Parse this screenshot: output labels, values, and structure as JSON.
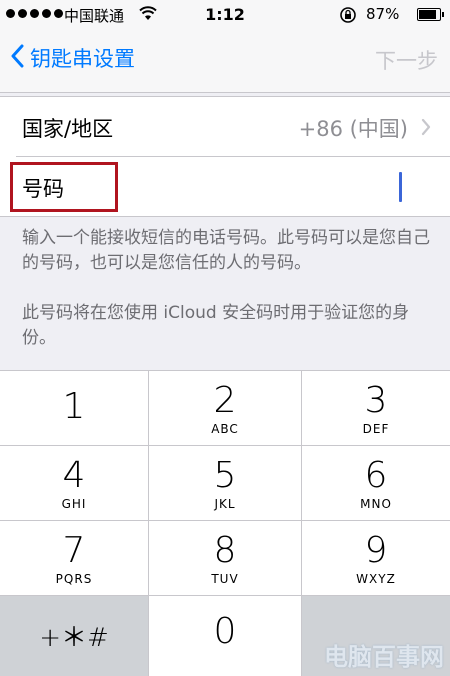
{
  "status_bar": {
    "carrier": "中国联通",
    "time": "1:12",
    "battery": "87%",
    "battery_level": 0.87
  },
  "nav": {
    "back_label": "钥匙串设置",
    "next_label": "下一步"
  },
  "form": {
    "country_label": "国家/地区",
    "country_value": "+86 (中国)",
    "phone_label": "号码",
    "phone_value": ""
  },
  "footer": {
    "line1": "输入一个能接收短信的电话号码。此号码可以是您自己的号码，也可以是您信任的人的号码。",
    "line2": "此号码将在您使用 iCloud 安全码时用于验证您的身份。"
  },
  "keypad": {
    "k1": {
      "num": "1",
      "letters": ""
    },
    "k2": {
      "num": "2",
      "letters": "ABC"
    },
    "k3": {
      "num": "3",
      "letters": "DEF"
    },
    "k4": {
      "num": "4",
      "letters": "GHI"
    },
    "k5": {
      "num": "5",
      "letters": "JKL"
    },
    "k6": {
      "num": "6",
      "letters": "MNO"
    },
    "k7": {
      "num": "7",
      "letters": "PQRS"
    },
    "k8": {
      "num": "8",
      "letters": "TUV"
    },
    "k9": {
      "num": "9",
      "letters": "WXYZ"
    },
    "k0": {
      "num": "0"
    },
    "symbols": "+＊#"
  },
  "watermark": "电脑百事网"
}
